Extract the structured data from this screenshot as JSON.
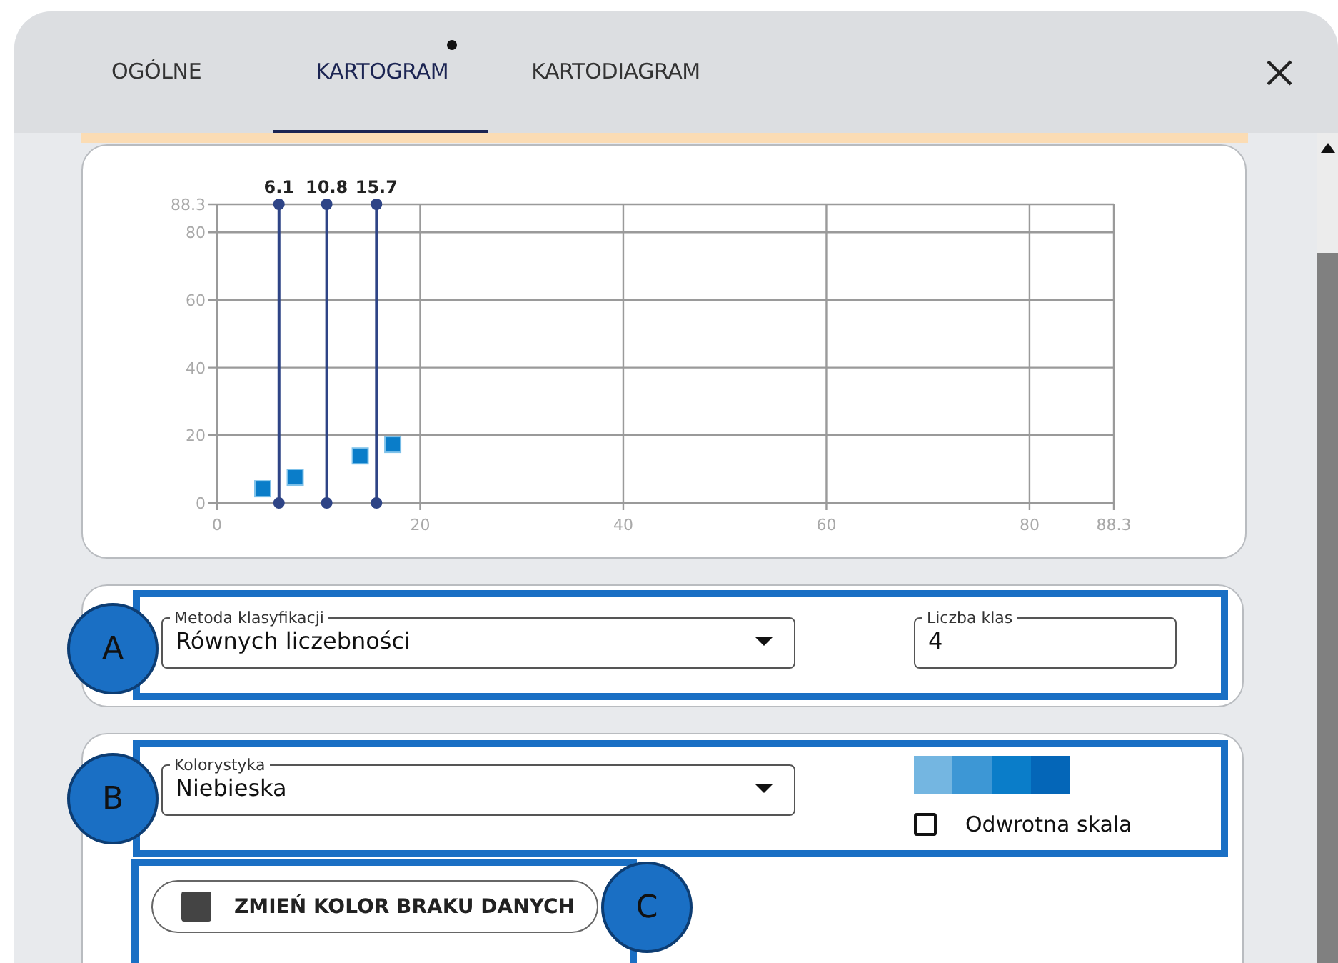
{
  "dialog": {
    "tabs": [
      {
        "label": "OGÓLNE",
        "selected": false,
        "modified": false
      },
      {
        "label": "KARTOGRAM",
        "selected": true,
        "modified": true
      },
      {
        "label": "KARTODIAGRAM",
        "selected": false,
        "modified": false
      }
    ]
  },
  "chart": {
    "chart_data": {
      "type": "scatter",
      "xlim": [
        0,
        88.3
      ],
      "ylim": [
        0,
        88.3
      ],
      "xticks": [
        0,
        20,
        40,
        60,
        80,
        88.3
      ],
      "yticks": [
        0,
        20,
        40,
        60,
        80,
        88.3
      ],
      "x": [
        4.5,
        7.7,
        14.1,
        17.3
      ],
      "grid": true,
      "series": [
        {
          "color": "#0a7dc9",
          "values": [
            4.2,
            7.6,
            13.9,
            17.3
          ]
        }
      ],
      "ref_lines": [
        {
          "axis": "x",
          "value": 6.1,
          "label": "6.1"
        },
        {
          "axis": "x",
          "value": 10.8,
          "label": "10.8"
        },
        {
          "axis": "x",
          "value": 15.7,
          "label": "15.7"
        }
      ]
    }
  },
  "classification": {
    "callout": "A",
    "method": {
      "label": "Metoda klasyfikacji",
      "value": "Równych liczebności"
    },
    "class_count": {
      "label": "Liczba klas",
      "value": "4"
    }
  },
  "coloring": {
    "callout": "B",
    "scheme": {
      "label": "Kolorystyka",
      "value": "Niebieska"
    },
    "swatches": [
      {
        "color": "#74b6e1"
      },
      {
        "color": "#3d97d5"
      },
      {
        "color": "#0a7dc9"
      },
      {
        "color": "#0466b8"
      }
    ],
    "reverse": {
      "label": "Odwrotna skala",
      "checked": false
    },
    "no_data": {
      "callout": "C",
      "label": "ZMIEŃ KOLOR BRAKU DANYCH"
    }
  }
}
